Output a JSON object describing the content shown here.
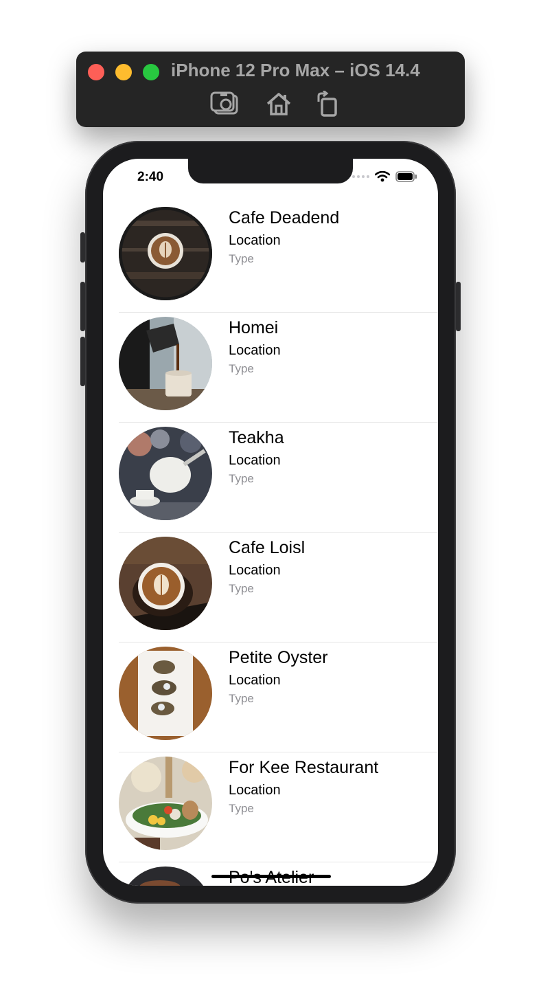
{
  "simulator": {
    "title": "iPhone 12 Pro Max – iOS 14.4",
    "toolbar": [
      "camera-icon",
      "home-icon",
      "rotate-icon"
    ]
  },
  "status_bar": {
    "time": "2:40",
    "icons": [
      "cellular-icon",
      "wifi-icon",
      "battery-icon"
    ]
  },
  "restaurants": [
    {
      "name": "Cafe Deadend",
      "location": "Location",
      "type": "Type",
      "image": "latte-on-wood"
    },
    {
      "name": "Homei",
      "location": "Location",
      "type": "Type",
      "image": "pour-over-coffee"
    },
    {
      "name": "Teakha",
      "location": "Location",
      "type": "Type",
      "image": "teapot-pouring"
    },
    {
      "name": "Cafe Loisl",
      "location": "Location",
      "type": "Type",
      "image": "latte-art-cup"
    },
    {
      "name": "Petite Oyster",
      "location": "Location",
      "type": "Type",
      "image": "oyster-plate"
    },
    {
      "name": "For Kee Restaurant",
      "location": "Location",
      "type": "Type",
      "image": "salad-bowl"
    },
    {
      "name": "Po's Atelier",
      "location": "",
      "type": "",
      "image": "dark-plate"
    }
  ],
  "colors": {
    "tint_gray": "#8e8e93",
    "separator": "#e6e6e6",
    "frame": "#1c1c1e"
  }
}
